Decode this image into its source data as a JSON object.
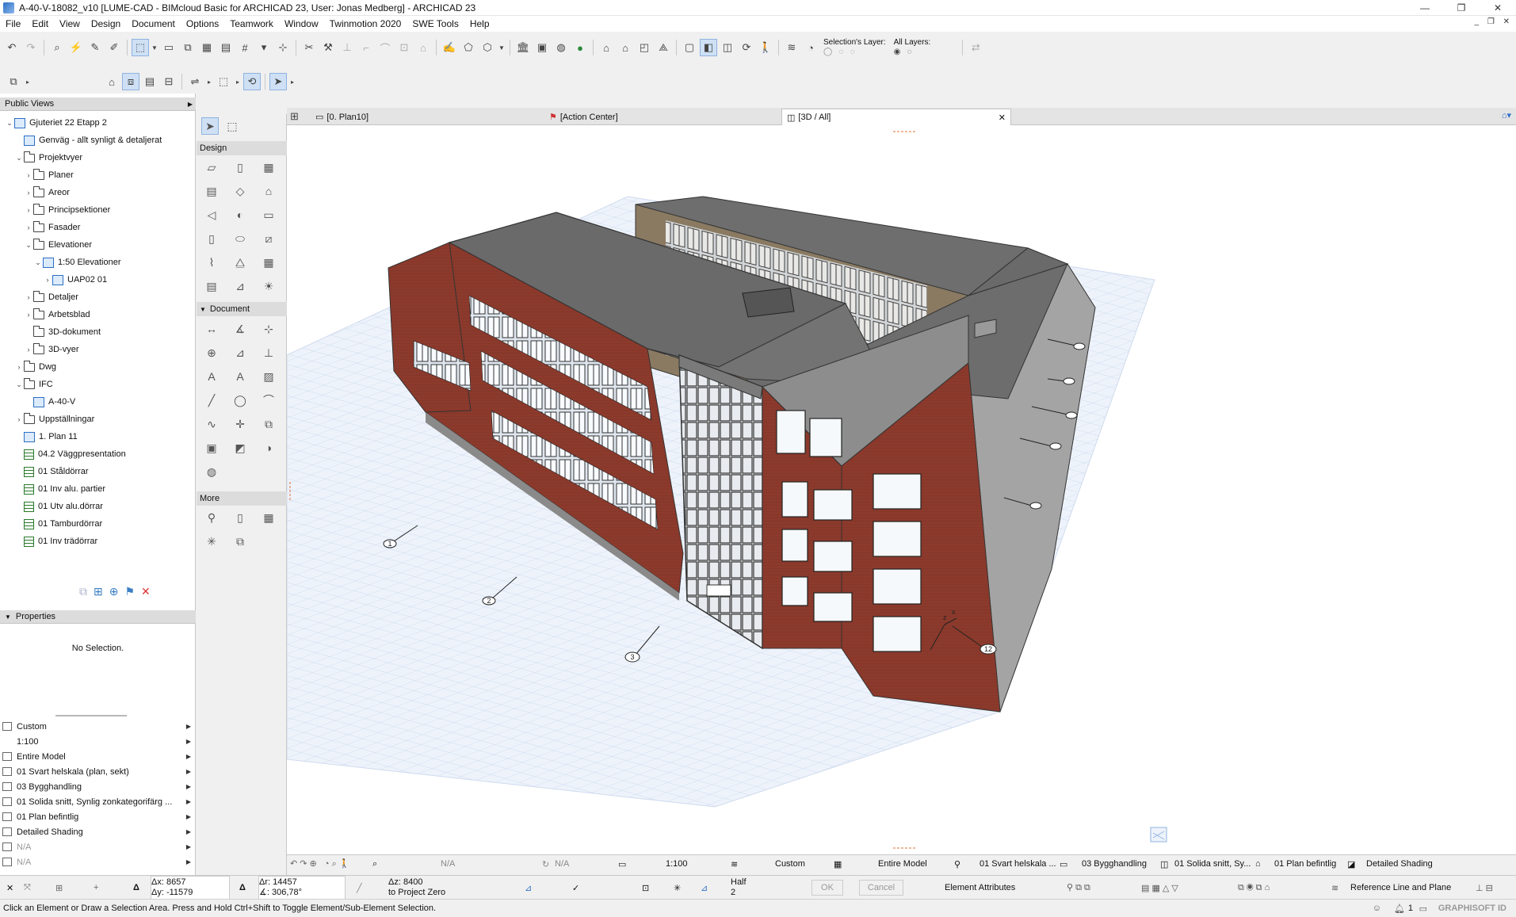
{
  "window": {
    "title": "A-40-V-18082_v10 [LUME-CAD - BIMcloud Basic for ARCHICAD 23, User: Jonas Medberg] - ARCHICAD 23",
    "minimize": "—",
    "restore": "❐",
    "close": "✕"
  },
  "menu": [
    "File",
    "Edit",
    "View",
    "Design",
    "Document",
    "Options",
    "Teamwork",
    "Window",
    "Twinmotion 2020",
    "SWE Tools",
    "Help"
  ],
  "mdi_controls": "_ ❐ ✕",
  "toolbar": {
    "selection_layer_label": "Selection's Layer:",
    "all_layers_label": "All Layers:"
  },
  "navigator": {
    "header": "Public Views",
    "items": [
      {
        "label": "Gjuteriet 22 Etapp 2",
        "icon": "project-icon",
        "arrow": "v"
      },
      {
        "label": "Genväg - allt synligt & detaljerat",
        "icon": "view-icon",
        "arrow": ""
      },
      {
        "label": "Projektvyer",
        "icon": "folder-icon",
        "arrow": "v"
      },
      {
        "label": "Planer",
        "icon": "folder-icon",
        "arrow": ">"
      },
      {
        "label": "Areor",
        "icon": "folder-icon",
        "arrow": ">"
      },
      {
        "label": "Principsektioner",
        "icon": "folder-icon",
        "arrow": ">"
      },
      {
        "label": "Fasader",
        "icon": "folder-icon",
        "arrow": ">"
      },
      {
        "label": "Elevationer",
        "icon": "folder-icon",
        "arrow": "v"
      },
      {
        "label": "1:50 Elevationer",
        "icon": "view-icon",
        "arrow": "v"
      },
      {
        "label": "UAP02 01",
        "icon": "elevation-icon",
        "arrow": ">"
      },
      {
        "label": "Detaljer",
        "icon": "folder-icon",
        "arrow": ">"
      },
      {
        "label": "Arbetsblad",
        "icon": "folder-icon",
        "arrow": ">"
      },
      {
        "label": "3D-dokument",
        "icon": "folder-icon",
        "arrow": ""
      },
      {
        "label": "3D-vyer",
        "icon": "folder-icon",
        "arrow": ">"
      },
      {
        "label": "Dwg",
        "icon": "folder-icon",
        "arrow": ">"
      },
      {
        "label": "IFC",
        "icon": "folder-icon",
        "arrow": "v"
      },
      {
        "label": "A-40-V",
        "icon": "view-icon",
        "arrow": ""
      },
      {
        "label": "Uppställningar",
        "icon": "folder-icon",
        "arrow": ">"
      },
      {
        "label": "1. Plan 11",
        "icon": "view-icon",
        "arrow": ""
      },
      {
        "label": "04.2 Väggpresentation",
        "icon": "schedule-icon",
        "arrow": ""
      },
      {
        "label": "01 Ståldörrar",
        "icon": "schedule-icon",
        "arrow": ""
      },
      {
        "label": "01 Inv alu. partier",
        "icon": "schedule-icon",
        "arrow": ""
      },
      {
        "label": "01 Utv alu.dörrar",
        "icon": "schedule-icon",
        "arrow": ""
      },
      {
        "label": "01 Tamburdörrar",
        "icon": "schedule-icon",
        "arrow": ""
      },
      {
        "label": "01 Inv trädörrar",
        "icon": "schedule-icon",
        "arrow": ""
      }
    ]
  },
  "properties": {
    "header": "Properties",
    "empty_text": "No Selection."
  },
  "view_settings": [
    {
      "label": "Custom",
      "icon": "layers-icon"
    },
    {
      "label": "1:100",
      "icon": ""
    },
    {
      "label": "Entire Model",
      "icon": "structure-icon"
    },
    {
      "label": "01 Svart helskala (plan, sekt)",
      "icon": "pen-icon"
    },
    {
      "label": "03 Bygghandling",
      "icon": "model-view-icon"
    },
    {
      "label": "01 Solida snitt, Synlig zonkategorifärg ...",
      "icon": "override-icon"
    },
    {
      "label": "01 Plan befintlig",
      "icon": "renovation-icon"
    },
    {
      "label": "Detailed Shading",
      "icon": "shading-icon"
    },
    {
      "label": "N/A",
      "icon": "zoom-icon"
    },
    {
      "label": "N/A",
      "icon": "angle-icon"
    }
  ],
  "toolbox": {
    "design_header": "Design",
    "document_header": "Document",
    "more_header": "More"
  },
  "tabs": [
    {
      "label": "[0. Plan10]",
      "icon": "plan-icon"
    },
    {
      "label": "[Action Center]",
      "icon": "action-icon"
    },
    {
      "label": "[3D / All]",
      "icon": "3d-icon"
    }
  ],
  "tab_close": "✕",
  "navbar": {
    "zoom_value": "N/A",
    "angle_value": "N/A",
    "scale": "1:100",
    "layer_combo": "Custom",
    "structure": "Entire Model",
    "pen_set": "01 Svart helskala ...",
    "model_view": "03 Bygghandling",
    "override": "01 Solida snitt, Sy...",
    "renovation": "01 Plan befintlig",
    "shading": "Detailed Shading"
  },
  "infobox": {
    "dx": "Δx: 8657",
    "dy": "Δy: -11579",
    "dr": "Δr: 14457",
    "da": "∡: 306,78°",
    "dz": "Δz: 8400",
    "dz_ref": "to Project Zero",
    "half": "Half",
    "half_num": "2",
    "ok": "OK",
    "cancel": "Cancel",
    "attr": "Element Attributes",
    "refline": "Reference Line and Plane"
  },
  "status": {
    "message": "Click an Element or Draw a Selection Area. Press and Hold Ctrl+Shift to Toggle Element/Sub-Element Selection.",
    "notif_count": "1",
    "graphisoft": "GRAPHISOFT ID"
  },
  "viewport": {
    "axis_x": "x",
    "axis_z": "z",
    "grid_markers": [
      "1",
      "2",
      "3",
      "12"
    ]
  },
  "colors": {
    "brick": "#8a3b2c",
    "roof": "#6a6a6a",
    "grid": "#d3ddf0",
    "accent": "#2d6fc4"
  }
}
